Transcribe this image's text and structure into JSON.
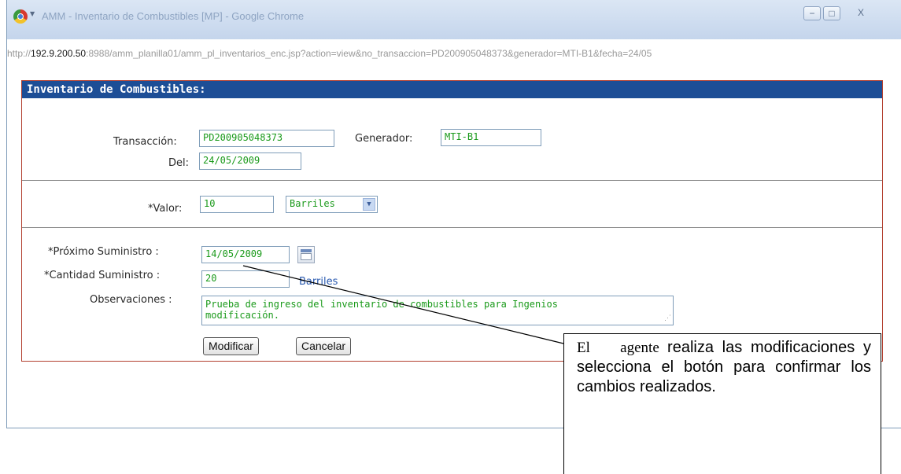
{
  "window": {
    "title": "AMM - Inventario de Combustibles [MP] - Google Chrome",
    "controls": {
      "minimize": "−",
      "maximize": "□",
      "close": "X"
    },
    "url_prefix": "http://",
    "url_host": "192.9.200.50",
    "url_rest": ":8988/amm_planilla01/amm_pl_inventarios_enc.jsp?action=view&no_transaccion=PD200905048373&generador=MTI-B1&fecha=24/05"
  },
  "form": {
    "header": "Inventario de Combustibles:",
    "transaccion": {
      "label": "Transacción:",
      "value": "PD200905048373"
    },
    "generador": {
      "label": "Generador:",
      "value": "MTI-B1"
    },
    "del": {
      "label": "Del:",
      "value": "24/05/2009"
    },
    "valor": {
      "label": "*Valor:",
      "value": "10",
      "unit_selected": "Barriles"
    },
    "proximo_suministro": {
      "label": "*Próximo Suministro :",
      "value": "14/05/2009"
    },
    "cantidad_suministro": {
      "label": "*Cantidad Suministro :",
      "value": "20",
      "unit": "Barriles"
    },
    "observaciones": {
      "label": "Observaciones :",
      "line1": "Prueba de ingreso del inventario de combustibles para Ingenios",
      "line2": "modificación."
    },
    "buttons": {
      "modificar": "Modificar",
      "cancelar": "Cancelar"
    }
  },
  "annotation": {
    "word1": "El",
    "word2": "agente",
    "rest": "realiza las modificaciones y selecciona el botón para confirmar los cambios realizados."
  },
  "colors": {
    "header_bg": "#1d4e96",
    "panel_border": "#b34030",
    "field_text": "#1a9a1a",
    "unit_text": "#2a5ab0"
  },
  "icons": {
    "browser": "chrome-logo",
    "calendar": "calendar-icon",
    "dropdown": "chevron-down-icon"
  }
}
